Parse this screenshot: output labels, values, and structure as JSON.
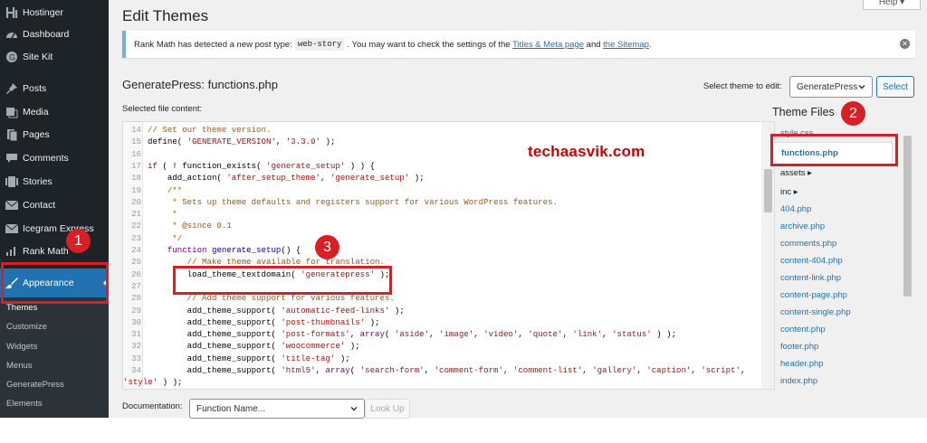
{
  "sidebar": {
    "items": [
      {
        "label": "Hostinger",
        "icon": "hostinger-icon"
      },
      {
        "label": "Dashboard",
        "icon": "dashboard-icon"
      },
      {
        "label": "Site Kit",
        "icon": "sitekit-icon"
      },
      {
        "label": "Posts",
        "icon": "pin-icon"
      },
      {
        "label": "Media",
        "icon": "media-icon"
      },
      {
        "label": "Pages",
        "icon": "pages-icon"
      },
      {
        "label": "Comments",
        "icon": "comment-icon"
      },
      {
        "label": "Stories",
        "icon": "stories-icon"
      },
      {
        "label": "Contact",
        "icon": "mail-icon"
      },
      {
        "label": "Icegram Express",
        "icon": "icegram-icon"
      },
      {
        "label": "Rank Math",
        "icon": "chart-icon"
      },
      {
        "label": "Appearance",
        "icon": "brush-icon"
      }
    ],
    "submenu": [
      "Themes",
      "Customize",
      "Widgets",
      "Menus",
      "GeneratePress",
      "Elements"
    ]
  },
  "header": {
    "title": "Edit Themes",
    "help": "Help ▾"
  },
  "notice": {
    "text1": "Rank Math has detected a new post type:",
    "code": "web-story",
    "text2": ". You may want to check the settings of the",
    "link1": "Titles & Meta page",
    "text3": "and",
    "link2": "the Sitemap",
    "text4": "."
  },
  "editor": {
    "file_title": "GeneratePress: functions.php",
    "select_label": "Select theme to edit:",
    "theme": "GeneratePress",
    "select_button": "Select",
    "selected_file_label": "Selected file content:"
  },
  "theme_files": {
    "title": "Theme Files",
    "items": [
      "style.css",
      "functions.php",
      "assets ▸",
      "inc ▸",
      "404.php",
      "archive.php",
      "comments.php",
      "content-404.php",
      "content-link.php",
      "content-page.php",
      "content-single.php",
      "content.php",
      "footer.php",
      "header.php",
      "index.php"
    ]
  },
  "documentation": {
    "label": "Documentation:",
    "placeholder": "Function Name...",
    "button": "Look Up"
  },
  "watermark": "techaasvik.com",
  "annotations": [
    "1",
    "2",
    "3"
  ],
  "colors": {
    "accent": "#2271b1",
    "highlight": "#d91f26",
    "sidebar": "#1d2327"
  }
}
